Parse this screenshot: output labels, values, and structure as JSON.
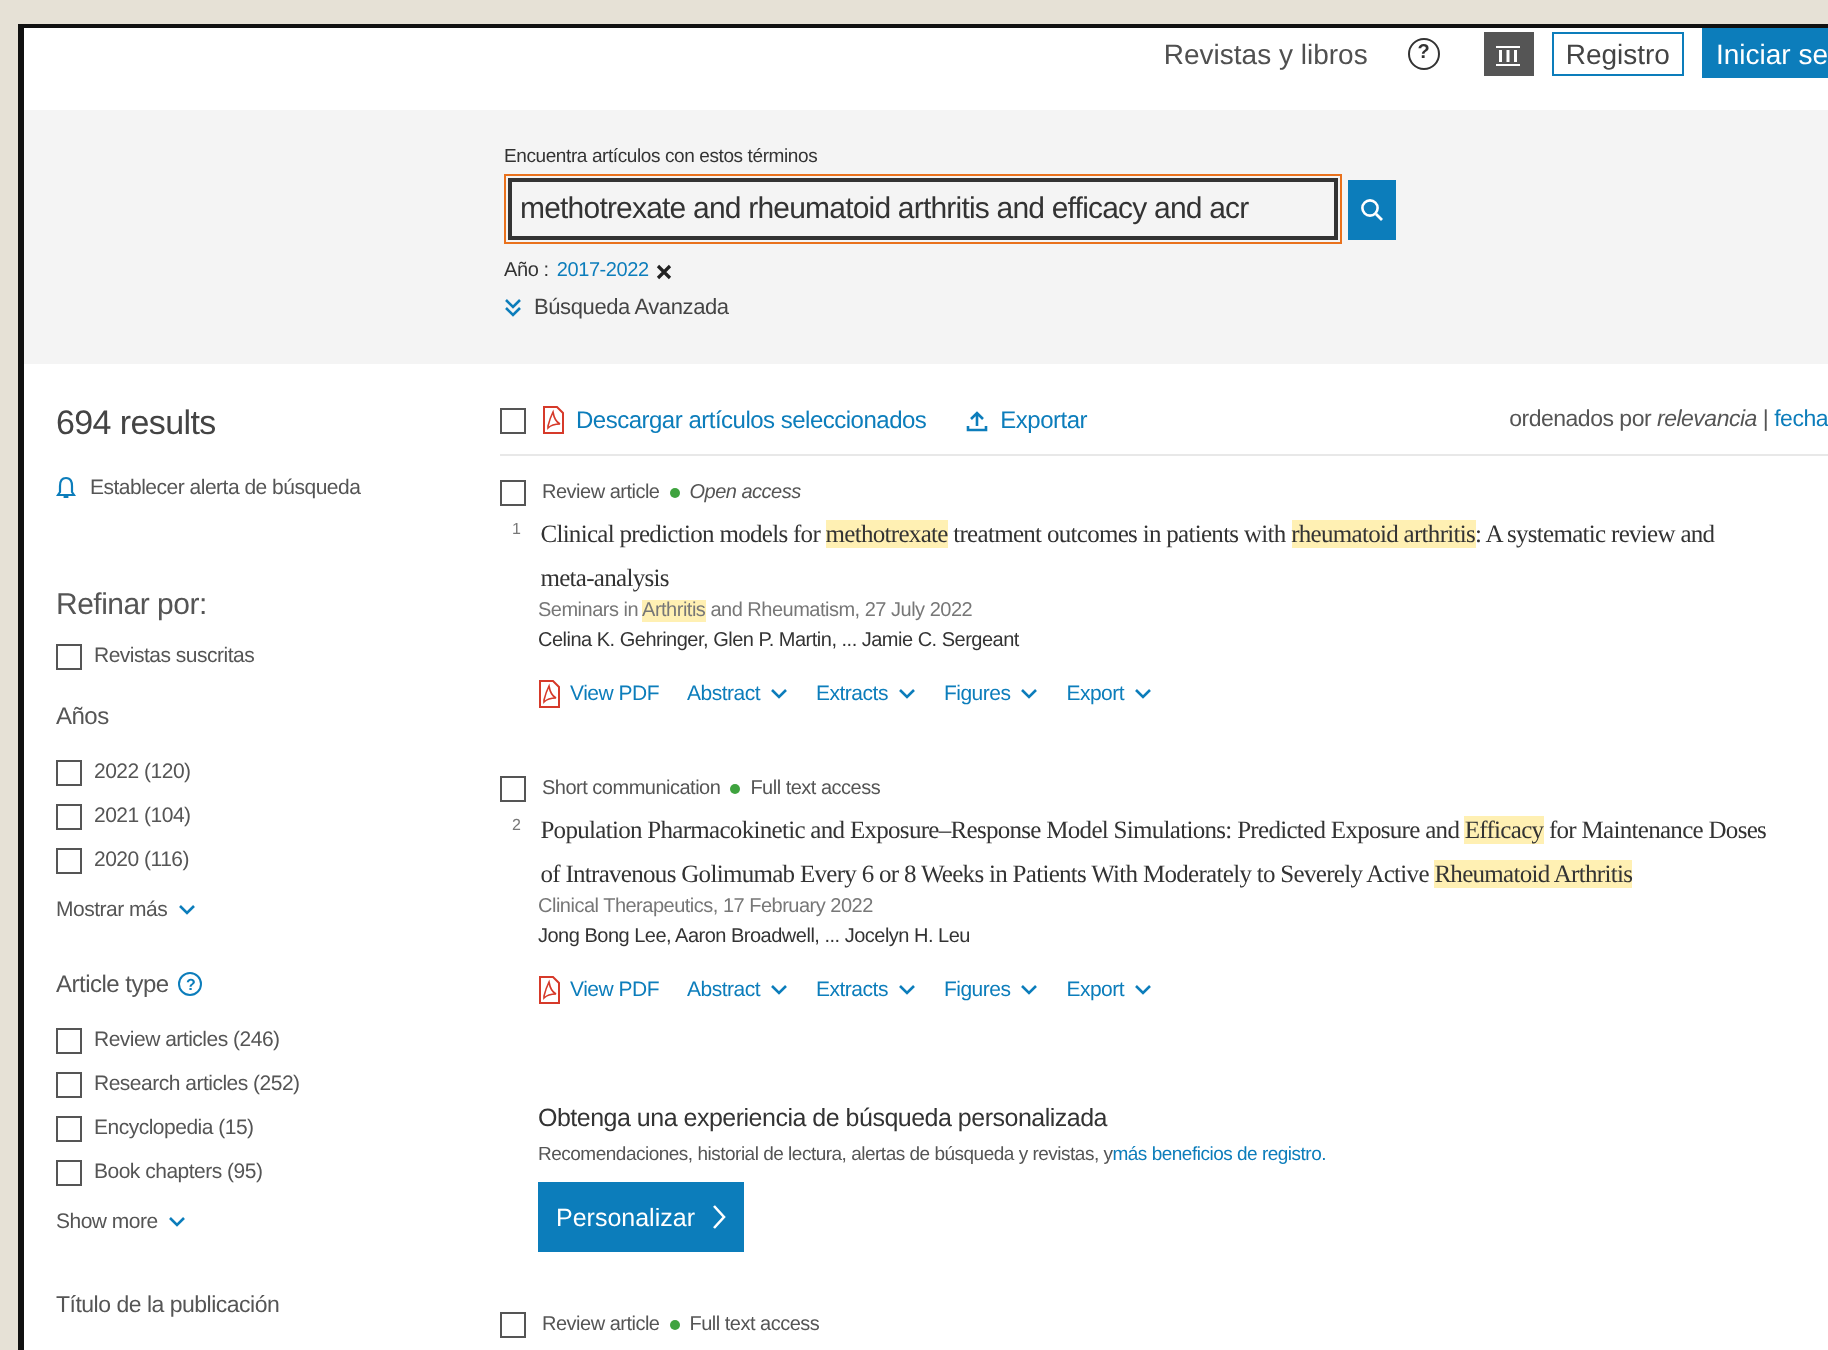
{
  "header": {
    "nav_link": "Revistas y libros",
    "help_icon": "?",
    "register": "Registro",
    "sign_in": "Iniciar se"
  },
  "search": {
    "label": "Encuentra artículos con estos términos",
    "value": "methotrexate and rheumatoid arthritis and efficacy and acr",
    "filter_label": "Año :",
    "filter_value": "2017-2022",
    "advanced": "Búsqueda Avanzada"
  },
  "sidebar": {
    "count": "694 results",
    "alert": "Establecer alerta de búsqueda",
    "refine_title": "Refinar por:",
    "subscribed": {
      "label": "Revistas suscritas",
      "checked": false
    },
    "years_title": "Años",
    "years": [
      {
        "label": "2022 (120)",
        "checked": false
      },
      {
        "label": "2021 (104)",
        "checked": false
      },
      {
        "label": "2020 (116)",
        "checked": false
      }
    ],
    "years_more": "Mostrar más",
    "types_title": "Article type",
    "types_help": "?",
    "types": [
      {
        "label": "Review articles (246)",
        "checked": false
      },
      {
        "label": "Research articles (252)",
        "checked": false
      },
      {
        "label": "Encyclopedia (15)",
        "checked": false
      },
      {
        "label": "Book chapters (95)",
        "checked": false
      }
    ],
    "types_more": "Show more",
    "publication_title": "Título de la publicación"
  },
  "toolbar": {
    "select_all_checked": false,
    "download": "Descargar artículos seleccionados",
    "export": "Exportar",
    "sort": "ordenados por *relevancia* |",
    "sort_link": "fecha"
  },
  "feed": [
    {
      "kind": "article",
      "checked": false,
      "type": "Review article",
      "access": "Open access",
      "open_access": true,
      "number": "1",
      "title": [
        {
          "text": "Clinical prediction models for ",
          "highlight": false
        },
        {
          "text": "methotrexate",
          "highlight": true
        },
        {
          "text": " treatment outcomes in patients with ",
          "highlight": false
        },
        {
          "text": "rheumatoid arthritis",
          "highlight": true
        },
        {
          "text": ": A systematic review and meta-analysis",
          "highlight": false
        }
      ],
      "source": [
        {
          "text": "Seminars in ",
          "highlight": false
        },
        {
          "text": "Arthritis",
          "highlight": true
        },
        {
          "text": " and Rheumatism, 27 July 2022",
          "highlight": false
        }
      ],
      "authors": "Celina K. Gehringer, Glen P. Martin, ... Jamie C. Sergeant",
      "actions": [
        {
          "label": "View PDF",
          "kind": "pdf"
        },
        {
          "label": "Abstract",
          "kind": "menu"
        },
        {
          "label": "Extracts",
          "kind": "menu"
        },
        {
          "label": "Figures",
          "kind": "menu"
        },
        {
          "label": "Export",
          "kind": "menu"
        }
      ]
    },
    {
      "kind": "article",
      "checked": false,
      "type": "Short communication",
      "access": "Full text access",
      "open_access": false,
      "number": "2",
      "title": [
        {
          "text": "Population Pharmacokinetic and Exposure–Response Model Simulations: Predicted Exposure and ",
          "highlight": false
        },
        {
          "text": "Efficacy",
          "highlight": true
        },
        {
          "text": " for Maintenance Doses of Intravenous Golimumab Every 6 or 8 Weeks in Patients With Moderately to Severely Active ",
          "highlight": false
        },
        {
          "text": "Rheumatoid Arthritis",
          "highlight": true
        }
      ],
      "source": [
        {
          "text": "Clinical Therapeutics, 17 February 2022",
          "highlight": false
        }
      ],
      "authors": "Jong Bong Lee, Aaron Broadwell, ... Jocelyn H. Leu",
      "actions": [
        {
          "label": "View PDF",
          "kind": "pdf"
        },
        {
          "label": "Abstract",
          "kind": "menu"
        },
        {
          "label": "Extracts",
          "kind": "menu"
        },
        {
          "label": "Figures",
          "kind": "menu"
        },
        {
          "label": "Export",
          "kind": "menu"
        }
      ]
    },
    {
      "kind": "promo",
      "title": "Obtenga una experiencia de búsqueda personalizada",
      "text": "Recomendaciones, historial de lectura, alertas de búsqueda y revistas, y",
      "link": "más beneficios de registro.",
      "button": "Personalizar"
    },
    {
      "kind": "article",
      "checked": false,
      "type": "Review article",
      "access": "Full text access",
      "open_access": false
    }
  ]
}
